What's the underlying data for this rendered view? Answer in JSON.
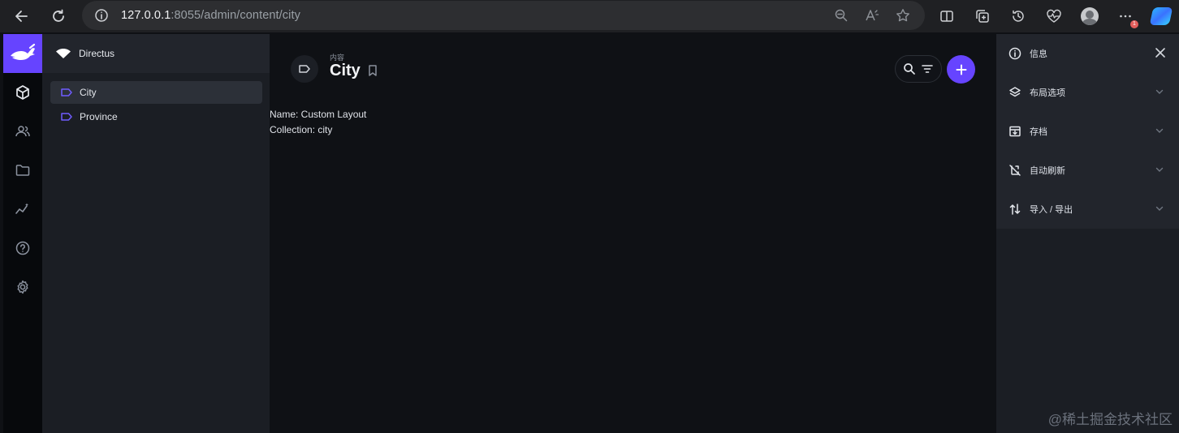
{
  "browser": {
    "url_host": "127.0.0.1",
    "url_path": ":8055/admin/content/city",
    "notification_count": "1"
  },
  "nav": {
    "project_name": "Directus",
    "items": [
      {
        "label": "City",
        "active": true
      },
      {
        "label": "Province",
        "active": false
      }
    ]
  },
  "header": {
    "breadcrumb": "内容",
    "title": "City"
  },
  "main": {
    "layout_name_line": "Name: Custom Layout",
    "collection_line": "Collection: city"
  },
  "sidebar": {
    "items": [
      {
        "label": "信息",
        "icon": "info-icon"
      },
      {
        "label": "布局选项",
        "icon": "layers-icon"
      },
      {
        "label": "存档",
        "icon": "archive-icon"
      },
      {
        "label": "自动刷新",
        "icon": "sync-disabled-icon"
      },
      {
        "label": "导入 / 导出",
        "icon": "import-export-icon"
      }
    ]
  },
  "watermark": "@稀土掘金技术社区",
  "colors": {
    "accent": "#6644ff",
    "background": "#0f1115",
    "nav_background": "#1b1e24"
  }
}
